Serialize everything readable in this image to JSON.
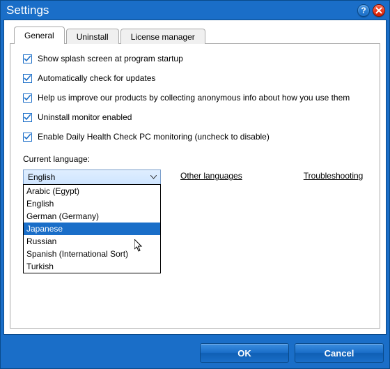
{
  "title": "Settings",
  "tabs": {
    "general": "General",
    "uninstall": "Uninstall",
    "license": "License manager"
  },
  "checks": {
    "splash": "Show splash screen at program startup",
    "update": "Automatically check for updates",
    "improve": "Help us improve our products by collecting anonymous info about how you use them",
    "monitor": "Uninstall monitor enabled",
    "dhc": "Enable Daily Health Check PC monitoring (uncheck to disable)"
  },
  "lang_label": "Current language:",
  "lang_selected": "English",
  "lang_options": {
    "ar": "Arabic (Egypt)",
    "en": "English",
    "de": "German (Germany)",
    "ja": "Japanese",
    "ru": "Russian",
    "es": "Spanish (International Sort)",
    "tr": "Turkish"
  },
  "links": {
    "other": "Other languages",
    "trouble": "Troubleshooting"
  },
  "buttons": {
    "ok": "OK",
    "cancel": "Cancel"
  }
}
